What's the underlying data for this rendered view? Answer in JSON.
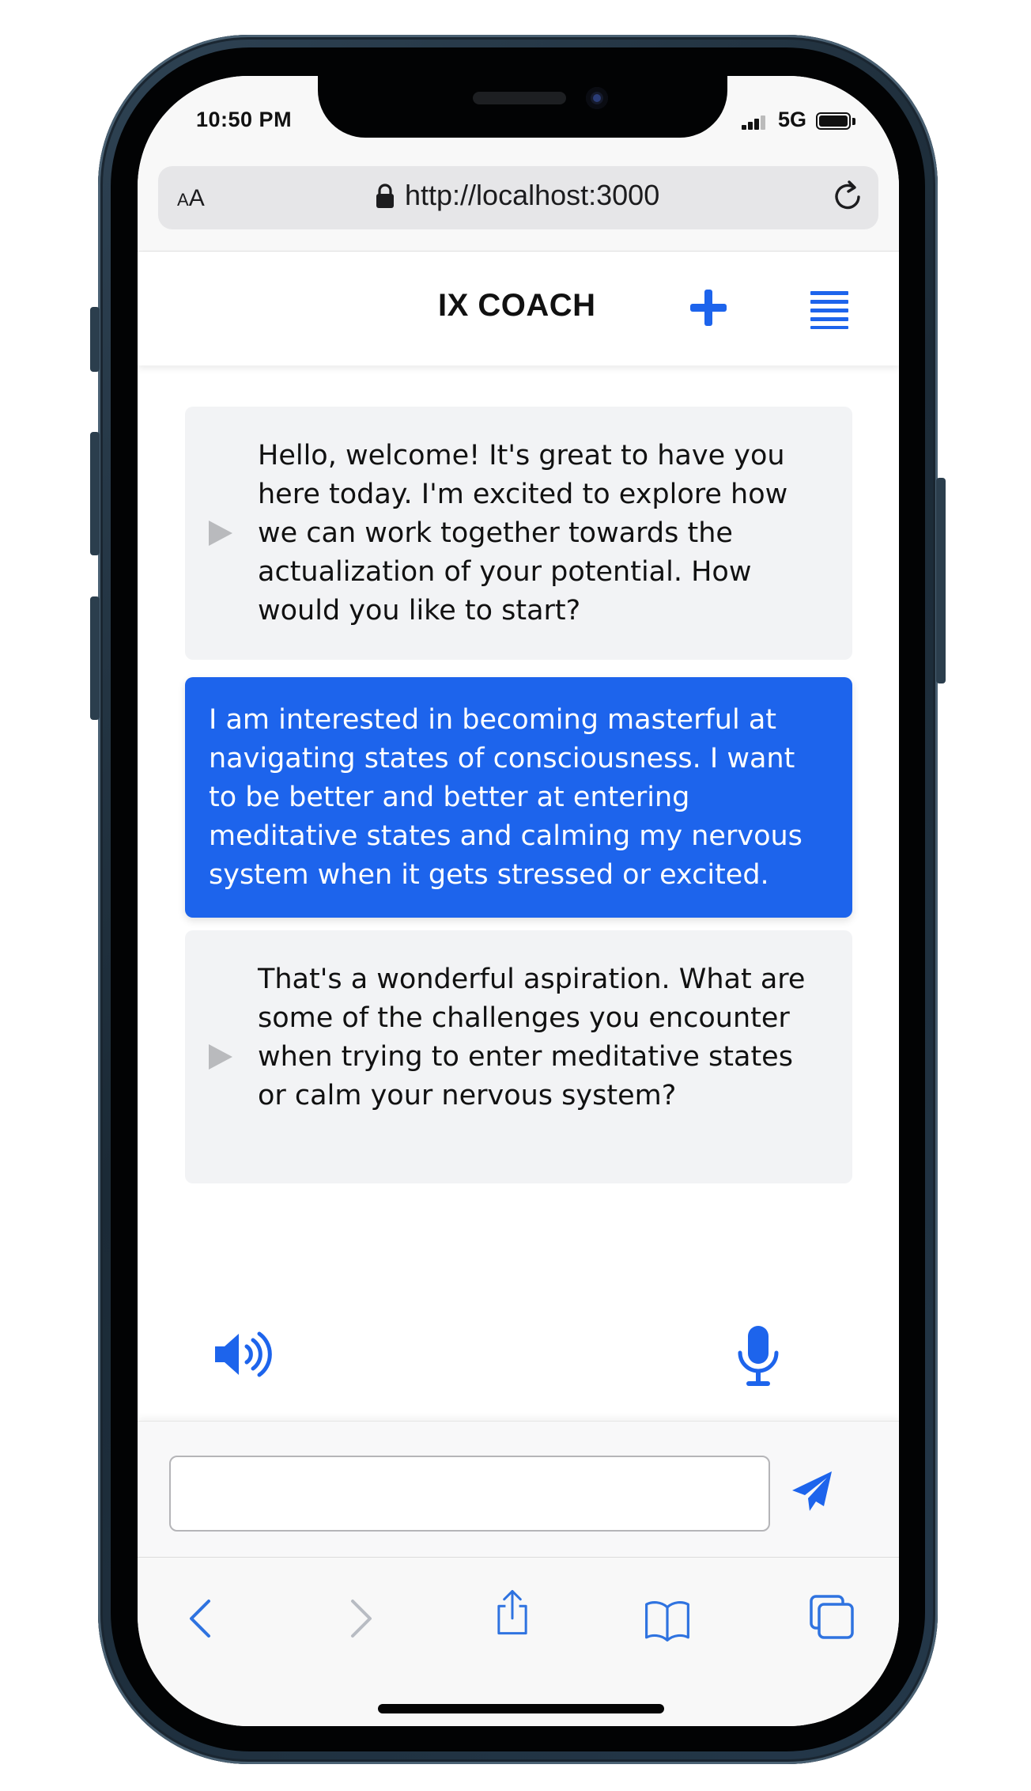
{
  "status_bar": {
    "time": "10:50 PM",
    "network": "5G",
    "signal_bars": 3,
    "battery_level": 1.0
  },
  "browser": {
    "text_size_label_small": "A",
    "text_size_label_large": "A",
    "url": "http://localhost:3000",
    "icons": [
      "lock-icon",
      "reload-icon"
    ]
  },
  "app": {
    "title": "IX COACH",
    "accent_color": "#1d64ec",
    "icons": [
      "plus-icon",
      "hamburger-menu-icon"
    ]
  },
  "messages": [
    {
      "role": "assistant",
      "text": "Hello, welcome! It's great to have you here today. I'm excited to explore how we can work together towards the actualization of your potential. How would you like to start?"
    },
    {
      "role": "user",
      "text": "I am interested in becoming masterful at navigating states of consciousness. I want to be better and better at entering meditative states and calming my nervous system when it gets stressed or excited."
    },
    {
      "role": "assistant",
      "text": "That's a wonderful aspiration. What are some of the challenges you encounter when trying to enter meditative states or calm your nervous system?"
    }
  ],
  "controls": {
    "speaker_icon": "speaker-volume-icon",
    "mic_icon": "microphone-icon"
  },
  "composer": {
    "input_value": "",
    "send_icon": "paper-plane-icon"
  },
  "safari_toolbar": {
    "icons": [
      "back-chevron-icon",
      "forward-chevron-icon",
      "share-icon",
      "bookmarks-icon",
      "tabs-icon"
    ],
    "forward_enabled": false
  },
  "colors": {
    "assistant_bubble": "#f2f3f5",
    "user_bubble": "#1d64ec",
    "toolbar_icon": "#2f73e0"
  }
}
